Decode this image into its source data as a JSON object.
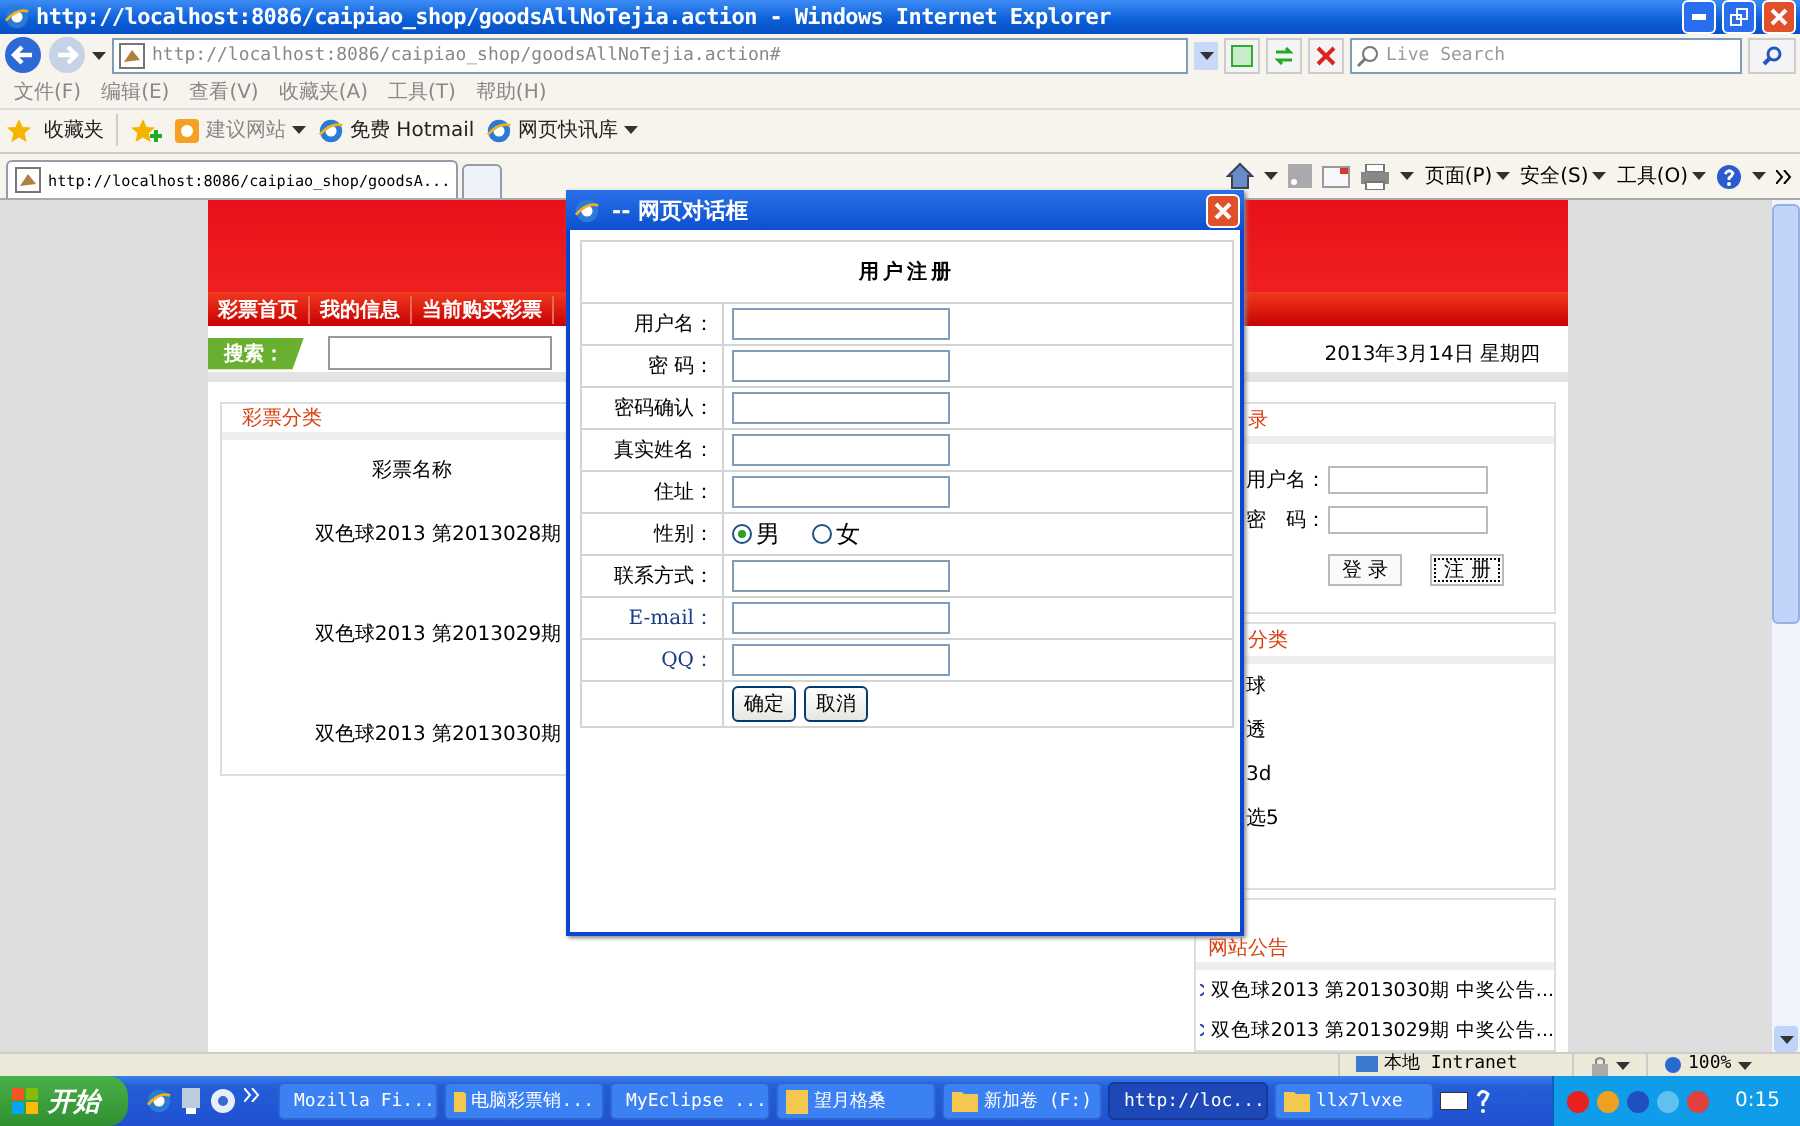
{
  "window": {
    "title": "http://localhost:8086/caipiao_shop/goodsAllNoTejia.action - Windows Internet Explorer"
  },
  "address_bar": {
    "value": "http://localhost:8086/caipiao_shop/goodsAllNoTejia.action#"
  },
  "search": {
    "placeholder": "Live Search"
  },
  "menu": [
    "文件(F)",
    "编辑(E)",
    "查看(V)",
    "收藏夹(A)",
    "工具(T)",
    "帮助(H)"
  ],
  "favorites_bar": {
    "favorites": "收藏夹",
    "links": [
      {
        "label": "建议网站",
        "dropdown": true
      },
      {
        "label": "免费 Hotmail",
        "dropdown": false
      },
      {
        "label": "网页快讯库",
        "dropdown": true
      }
    ]
  },
  "tabs": [
    {
      "label": "http://localhost:8086/caipiao_shop/goodsA...",
      "selected": true
    }
  ],
  "command_bar": [
    "页面(P)",
    "安全(S)",
    "工具(O)"
  ],
  "page": {
    "nav": [
      "彩票首页",
      "我的信息",
      "当前购买彩票"
    ],
    "search_label": "搜索：",
    "date": "2013年3月14日 星期四",
    "category_panel": {
      "title": "彩票分类",
      "column": "彩票名称",
      "rows": [
        "双色球2013 第2013028期",
        "双色球2013 第2013029期",
        "双色球2013 第2013030期"
      ]
    },
    "login_panel": {
      "title": "录",
      "username_label": "用户名：",
      "password_label": "密　码：",
      "buttons": [
        "登 录",
        "注 册"
      ]
    },
    "type_panel": {
      "title": "分类",
      "items": [
        "球",
        "透",
        "3d",
        "选5"
      ]
    },
    "notice_panel": {
      "title": "网站公告",
      "items": [
        "双色球2013 第2013030期 中奖公告...",
        "双色球2013 第2013029期 中奖公告..."
      ]
    }
  },
  "dialog": {
    "title": "-- 网页对话框",
    "heading": "用户注册",
    "fields": [
      {
        "label": "用户名：",
        "kind": "text"
      },
      {
        "label": "密 码：",
        "kind": "text"
      },
      {
        "label": "密码确认：",
        "kind": "text"
      },
      {
        "label": "真实姓名：",
        "kind": "text"
      },
      {
        "label": "住址：",
        "kind": "text"
      },
      {
        "label": "性别：",
        "kind": "radio",
        "options": [
          {
            "label": "男",
            "selected": true
          },
          {
            "label": "女",
            "selected": false
          }
        ]
      },
      {
        "label": "联系方式：",
        "kind": "text"
      },
      {
        "label": "E-mail：",
        "kind": "text"
      },
      {
        "label": "QQ：",
        "kind": "text"
      }
    ],
    "buttons": [
      "确定",
      "取消"
    ]
  },
  "status_bar": {
    "zone": "本地 Intranet",
    "zoom": "100%"
  },
  "taskbar": {
    "start": "开始",
    "tasks": [
      {
        "label": "Mozilla Fi...",
        "selected": false
      },
      {
        "label": "电脑彩票销...",
        "selected": false
      },
      {
        "label": "MyEclipse ...",
        "selected": false
      },
      {
        "label": "望月格桑",
        "selected": false
      },
      {
        "label": "新加卷 (F:)",
        "selected": false
      },
      {
        "label": "http://loc...",
        "selected": true
      },
      {
        "label": "llx7lvxe",
        "selected": false
      }
    ],
    "clock": "0:15"
  }
}
